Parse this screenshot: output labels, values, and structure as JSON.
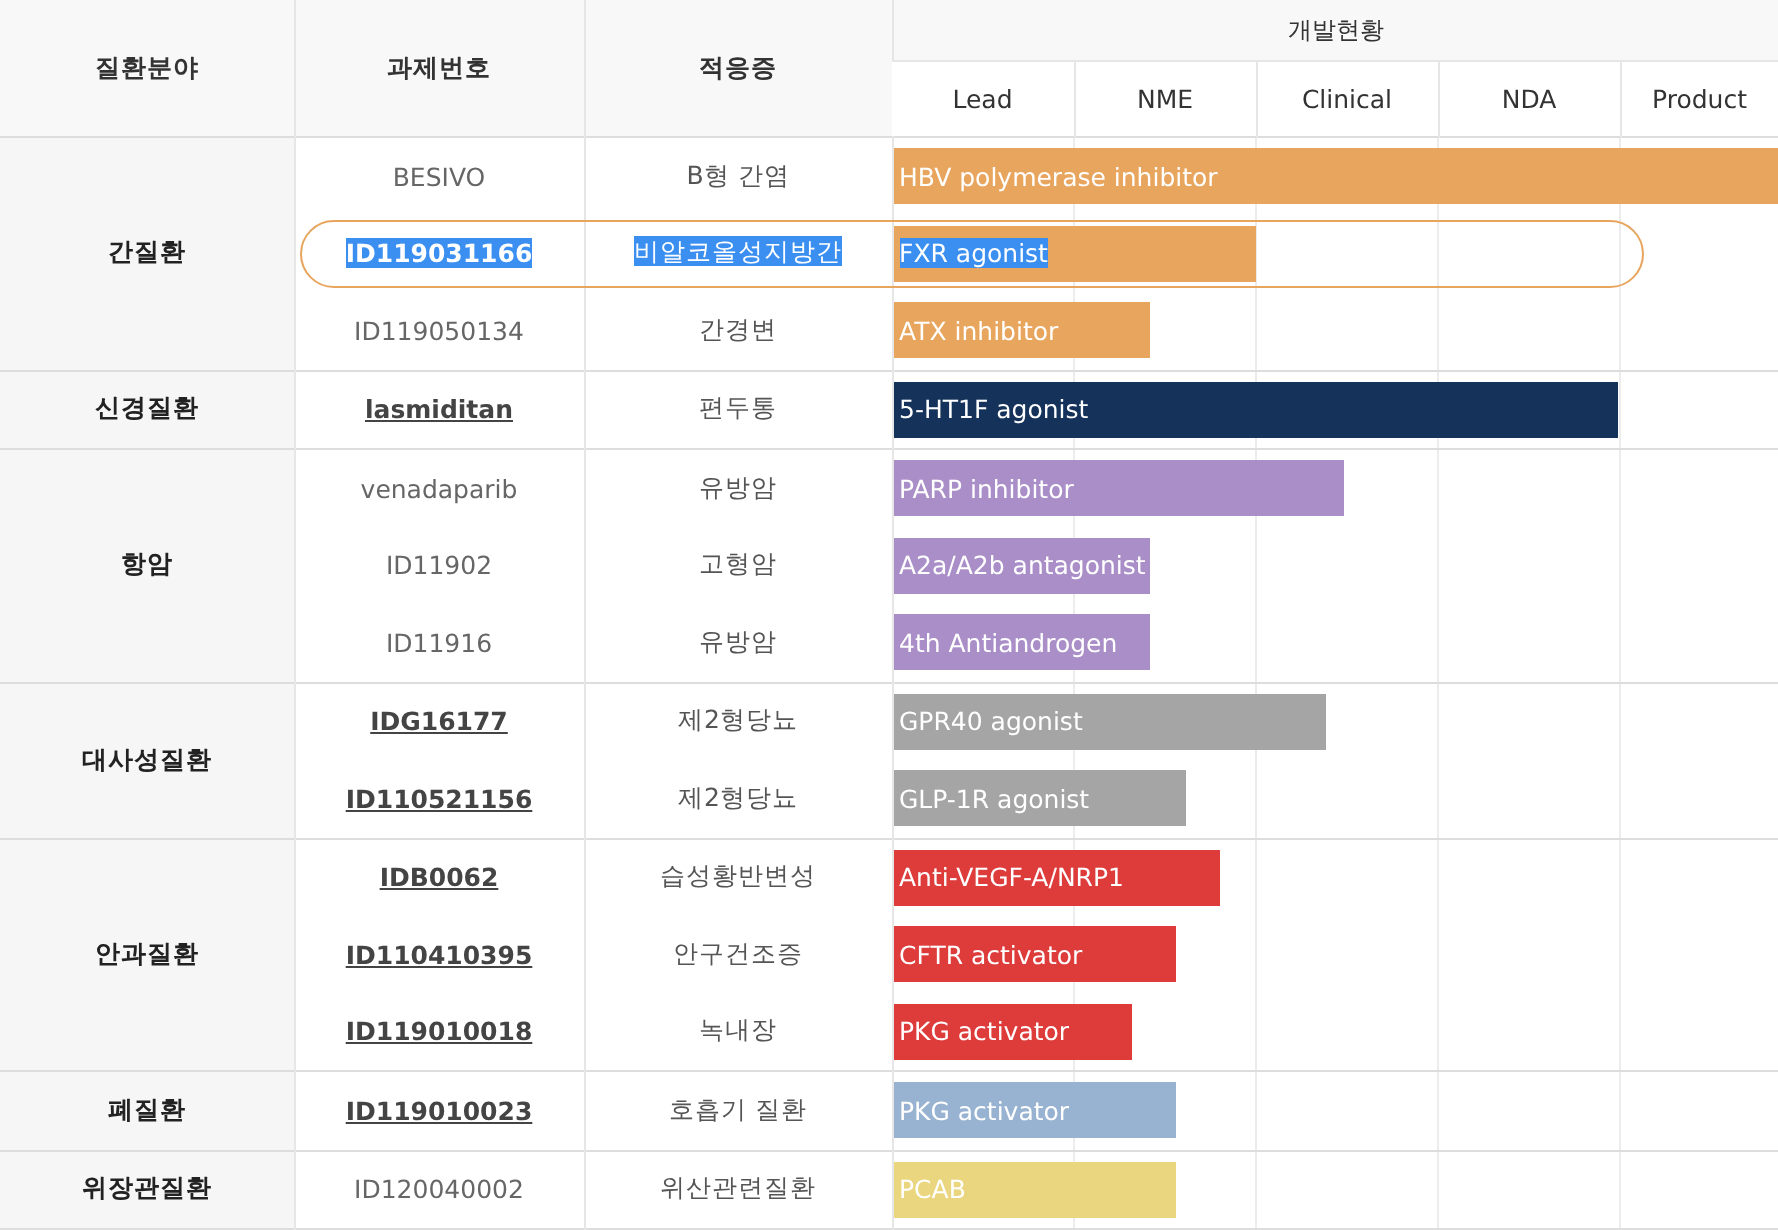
{
  "table": {
    "columns": [
      "질환분야",
      "과제번호",
      "적응증"
    ],
    "pipeline_header": "개발현황",
    "stages": [
      "Lead",
      "NME",
      "Clinical",
      "NDA",
      "Product"
    ],
    "groups": [
      {
        "area": "간질환",
        "rows": [
          {
            "id": "BESIVO",
            "linked": false,
            "highlighted": false,
            "indication": "B형 간염",
            "target": "HBV polymerase inhibitor",
            "level": 1.0,
            "color": "#e8a55e"
          },
          {
            "id": "ID119031166",
            "linked": false,
            "highlighted": true,
            "indication": "비알코올성지방간",
            "target": "FXR agonist",
            "level": 0.41,
            "color": "#e8a55e"
          },
          {
            "id": "ID119050134",
            "linked": false,
            "highlighted": false,
            "indication": "간경변",
            "target": "ATX inhibitor",
            "level": 0.29,
            "color": "#e8a55e"
          }
        ]
      },
      {
        "area": "신경질환",
        "rows": [
          {
            "id": "lasmiditan",
            "linked": true,
            "highlighted": false,
            "indication": "편두통",
            "target": "5-HT1F agonist",
            "level": 0.82,
            "color": "#14325a"
          }
        ]
      },
      {
        "area": "항암",
        "rows": [
          {
            "id": "venadaparib",
            "linked": false,
            "highlighted": false,
            "indication": "유방암",
            "target": "PARP inhibitor",
            "level": 0.51,
            "color": "#a98ec8"
          },
          {
            "id": "ID11902",
            "linked": false,
            "highlighted": false,
            "indication": "고형암",
            "target": "A2a/A2b antagonist",
            "level": 0.29,
            "color": "#a98ec8"
          },
          {
            "id": "ID11916",
            "linked": false,
            "highlighted": false,
            "indication": "유방암",
            "target": "4th Antiandrogen",
            "level": 0.29,
            "color": "#a98ec8"
          }
        ]
      },
      {
        "area": "대사성질환",
        "rows": [
          {
            "id": "IDG16177",
            "linked": true,
            "highlighted": false,
            "indication": "제2형당뇨",
            "target": "GPR40 agonist",
            "level": 0.49,
            "color": "#a5a5a5"
          },
          {
            "id": "ID110521156",
            "linked": true,
            "highlighted": false,
            "indication": "제2형당뇨",
            "target": "GLP-1R agonist",
            "level": 0.33,
            "color": "#a5a5a5"
          }
        ]
      },
      {
        "area": "안과질환",
        "rows": [
          {
            "id": "IDB0062",
            "linked": true,
            "highlighted": false,
            "indication": "습성황반변성",
            "target": "Anti-VEGF-A/NRP1",
            "level": 0.37,
            "color": "#de3b3b"
          },
          {
            "id": "ID110410395",
            "linked": true,
            "highlighted": false,
            "indication": "안구건조증",
            "target": "CFTR activator",
            "level": 0.32,
            "color": "#de3b3b"
          },
          {
            "id": "ID119010018",
            "linked": true,
            "highlighted": false,
            "indication": "녹내장",
            "target": "PKG activator",
            "level": 0.27,
            "color": "#de3b3b"
          }
        ]
      },
      {
        "area": "폐질환",
        "rows": [
          {
            "id": "ID119010023",
            "linked": true,
            "highlighted": false,
            "indication": "호흡기 질환",
            "target": "PKG activator",
            "level": 0.32,
            "color": "#98b3d1"
          }
        ]
      },
      {
        "area": "위장관질환",
        "rows": [
          {
            "id": "ID120040002",
            "linked": false,
            "highlighted": false,
            "indication": "위산관련질환",
            "target": "PCAB",
            "level": 0.32,
            "color": "#ead67e"
          }
        ]
      }
    ]
  }
}
